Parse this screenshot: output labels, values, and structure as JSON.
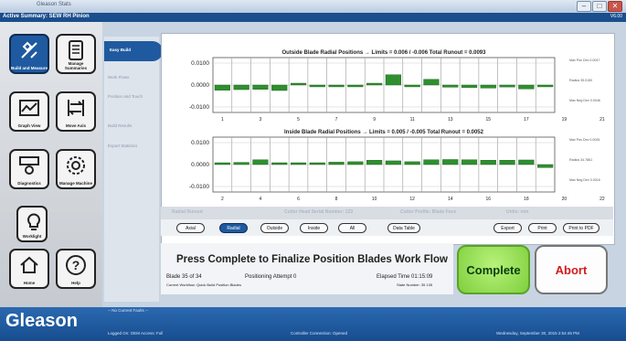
{
  "window": {
    "titlebar_text": "Gleason Stats",
    "header_title": "Active Summary: SEW RH Pinion",
    "version": "V6.00"
  },
  "sidebar": {
    "tiles": [
      {
        "label": "Build and Measure"
      },
      {
        "label": "Manage Summaries"
      },
      {
        "label": "Graph View"
      },
      {
        "label": "Move Axis"
      },
      {
        "label": "Diagnostics"
      },
      {
        "label": "Manage Machine"
      },
      {
        "label": "Worklight"
      },
      {
        "label": "Home"
      },
      {
        "label": "Help"
      }
    ]
  },
  "subnav": {
    "items": [
      {
        "label": "Easy Build"
      },
      {
        "label": "Work Flows"
      },
      {
        "label": "Position and Touch"
      },
      {
        "label": "Build Results"
      },
      {
        "label": "Export Statistics"
      }
    ]
  },
  "charts": [
    {
      "title": "Outside Blade Radial Positions → Limits = 0.006 / -0.006      Total Runout = 0.0093",
      "yticks": [
        "0.0100",
        "0.0000",
        "-0.0100"
      ],
      "xticks": [
        "1",
        "3",
        "5",
        "7",
        "9",
        "11",
        "13",
        "15",
        "17",
        "19",
        "21",
        "23",
        "25",
        "27",
        "29",
        "31",
        "33"
      ],
      "side": [
        "Max Pos Dev 0.0047",
        "Radius 35.0150",
        "Max Neg Dev 0.0046"
      ],
      "values": [
        -0.0024,
        -0.0021,
        -0.002,
        -0.0025,
        0.0008,
        -0.0002,
        -0.0003,
        -0.0005,
        0.0003,
        0.0047,
        -0.0003,
        0.0026,
        -0.001,
        -0.0012,
        -0.0014,
        -0.0009,
        -0.0018,
        -0.0007
      ]
    },
    {
      "title": "Inside Blade Radial Positions → Limits = 0.005 / -0.005      Total Runout = 0.0052",
      "yticks": [
        "0.0100",
        "0.0000",
        "-0.0100"
      ],
      "xticks": [
        "2",
        "4",
        "6",
        "8",
        "10",
        "12",
        "14",
        "16",
        "18",
        "20",
        "22",
        "24",
        "26",
        "28",
        "30",
        "32",
        "34"
      ],
      "side": [
        "Max Pos Dev 0.0026",
        "Radius 34.7861",
        "Max Neg Dev 0.0016"
      ],
      "values": [
        0.0008,
        0.001,
        0.0022,
        0.0008,
        0.0002,
        0.0008,
        0.0011,
        0.0013,
        0.002,
        0.0017,
        0.0013,
        0.0022,
        0.0023,
        0.0022,
        0.002,
        0.002,
        0.0021,
        -0.0014
      ]
    }
  ],
  "lower_band": {
    "radial_runout": "Radial Runout",
    "serial": "Cutter Head Serial Number: 123",
    "profile": "Cutter Profile: Blade Face",
    "units": "Units: mm"
  },
  "buttons": {
    "axial": "Axial",
    "radial": "Radial",
    "outside": "Outside",
    "inside": "Inside",
    "all": "All",
    "data_table": "Data Table",
    "export": "Export",
    "print": "Print",
    "print_pdf": "Print to PDF"
  },
  "workflow": {
    "message": "Press Complete to Finalize Position Blades Work Flow",
    "blade": "Blade 35 of 34",
    "attempt": "Positioning Attempt 0",
    "elapsed": "Elapsed Time 01:15:09",
    "current": "Current Workflow: Quick Build Position Blades",
    "state": "State Number: 35 135"
  },
  "actions": {
    "complete": "Complete",
    "abort": "Abort"
  },
  "status": {
    "logo": "Gleason",
    "faults": "-- No Current Faults --",
    "login": "Logged On: OEM   Access: Full",
    "connection": "Controller Connection: Opened",
    "datetime": "Wednesday, September 30, 2015 2:54:45 PM"
  },
  "colors": {
    "accent": "#1f5aa0",
    "bar": "#2f8f2f",
    "complete": "#7fcf3e",
    "abort_text": "#d21c1c"
  }
}
